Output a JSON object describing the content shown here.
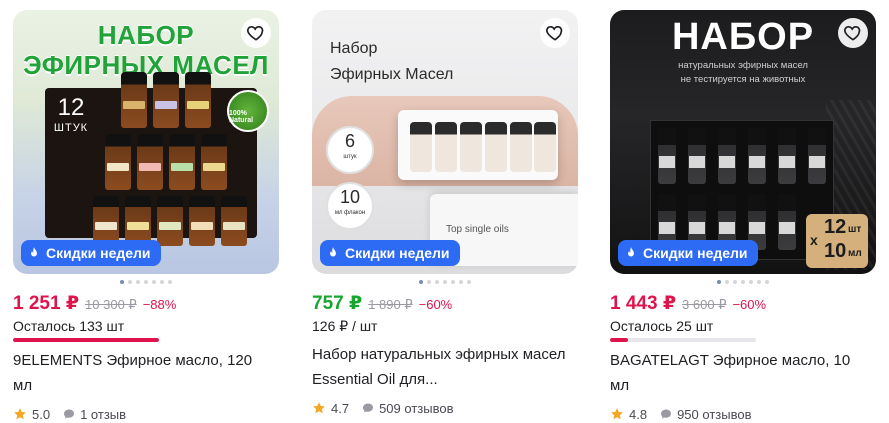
{
  "colors": {
    "sale_price": "#e0144c",
    "discount_price": "#19a630",
    "promo_badge": "#2e6bf5",
    "star": "#f5a623"
  },
  "products": [
    {
      "image_text": {
        "line1": "НАБОР",
        "line2": "ЭФИРНЫХ МАСЕЛ",
        "count": "12",
        "count_unit": "ШТУК",
        "badge": "100% Natural"
      },
      "promo": "Скидки недели",
      "price": "1 251 ₽",
      "old_price": "10 300 ₽",
      "discount": "−88%",
      "stock_text": "Осталось 133 шт",
      "stock_progress": 1.0,
      "title": "9ELEMENTS Эфирное масло, 120 мл",
      "rating": "5.0",
      "reviews": "1 отзыв"
    },
    {
      "image_text": {
        "line1": "Набор",
        "line2": "Эфирных Масел",
        "count1": "6",
        "count1_unit": "штук",
        "count2": "10",
        "count2_unit": "мл флакон",
        "box_label": "Top single oils"
      },
      "promo": "Скидки недели",
      "price": "757 ₽",
      "old_price": "1 890 ₽",
      "discount": "−60%",
      "unit_price": "126 ₽ / шт",
      "title": "Набор натуральных эфирных масел Essential Oil для...",
      "rating": "4.7",
      "reviews": "509 отзывов"
    },
    {
      "image_text": {
        "line1": "НАБОР",
        "line2": "натуральных эфирных масел",
        "line3": "не тестируется на животных",
        "badge_x": "x",
        "badge_n1": "12",
        "badge_u1": "шт",
        "badge_n2": "10",
        "badge_u2": "мл"
      },
      "promo": "Скидки недели",
      "price": "1 443 ₽",
      "old_price": "3 600 ₽",
      "discount": "−60%",
      "stock_text": "Осталось 25 шт",
      "stock_progress": 0.12,
      "title": "BAGATELAGT Эфирное масло, 10 мл",
      "rating": "4.8",
      "reviews": "950 отзывов"
    }
  ]
}
